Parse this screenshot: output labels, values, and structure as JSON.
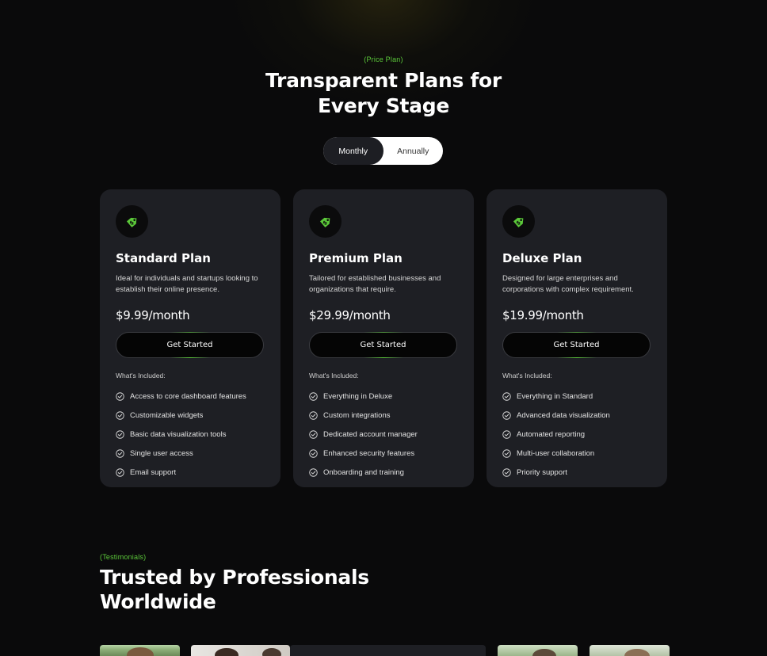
{
  "pricing": {
    "eyebrow": "(Price Plan)",
    "title_line1": "Transparent Plans for",
    "title_line2": "Every Stage",
    "toggle": {
      "monthly": "Monthly",
      "annually": "Annually",
      "selected": "Monthly"
    }
  },
  "plans": [
    {
      "icon": "price-tag-icon",
      "name": "Standard Plan",
      "desc": "Ideal for individuals and startups looking to establish their online presence.",
      "price": "$9.99/month",
      "cta": "Get Started",
      "included_label": "What's Included:",
      "features": [
        "Access to core dashboard features",
        "Customizable widgets",
        "Basic data visualization tools",
        "Single user access",
        "Email support"
      ]
    },
    {
      "icon": "price-tag-icon",
      "name": "Premium Plan",
      "desc": "Tailored for established businesses and organizations that require.",
      "price": "$29.99/month",
      "cta": "Get Started",
      "included_label": "What's Included:",
      "features": [
        "Everything in Deluxe",
        "Custom integrations",
        "Dedicated account manager",
        "Enhanced security features",
        "Onboarding and training"
      ]
    },
    {
      "icon": "price-tag-icon",
      "name": "Deluxe Plan",
      "desc": "Designed for large enterprises and corporations with complex requirement.",
      "price": "$19.99/month",
      "cta": "Get Started",
      "included_label": "What's Included:",
      "features": [
        "Everything in Standard",
        "Advanced data visualization",
        "Automated reporting",
        "Multi-user collaboration",
        "Priority support"
      ]
    }
  ],
  "testimonials": {
    "eyebrow": "(Testimonials)",
    "title_line1": "Trusted by Professionals",
    "title_line2": "Worldwide"
  },
  "colors": {
    "accent": "#5cc93a",
    "background": "#0a0a0b",
    "card": "#1e1f24"
  }
}
